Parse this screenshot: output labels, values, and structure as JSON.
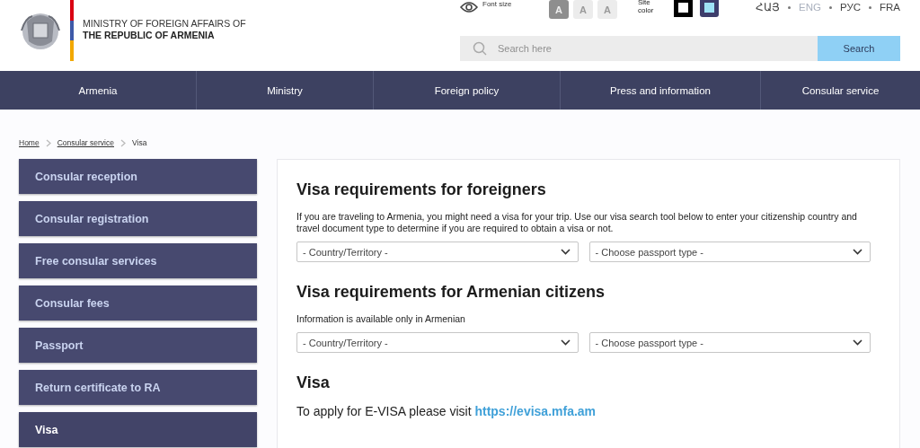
{
  "header": {
    "logo_line1": "MINISTRY OF FOREIGN AFFAIRS OF",
    "logo_line2": "THE REPUBLIC OF ARMENIA",
    "font_size_label": "Font size",
    "font_sizes": [
      {
        "label": "A",
        "selected": true
      },
      {
        "label": "A",
        "selected": false
      },
      {
        "label": "A",
        "selected": false
      }
    ],
    "site_color_label": "Site\ncolor",
    "site_colors": [
      {
        "color": "#000000",
        "selected": false
      },
      {
        "color": "#3d3d6b",
        "selected": true
      }
    ],
    "languages": [
      {
        "label": "ՀԱՅ",
        "selected": false
      },
      {
        "label": "ENG",
        "selected": true
      },
      {
        "label": "РУС",
        "selected": false
      },
      {
        "label": "FRA",
        "selected": false
      }
    ],
    "search": {
      "placeholder": "Search here",
      "button": "Search"
    }
  },
  "nav": [
    "Armenia",
    "Ministry",
    "Foreign policy",
    "Press and information",
    "Consular service"
  ],
  "breadcrumb": [
    {
      "label": "Home",
      "link": true
    },
    {
      "label": "Consular service",
      "link": true
    },
    {
      "label": "Visa",
      "link": false
    }
  ],
  "sidebar": [
    {
      "label": "Consular reception",
      "selected": false
    },
    {
      "label": "Consular registration",
      "selected": false
    },
    {
      "label": "Free consular services",
      "selected": false
    },
    {
      "label": "Consular fees",
      "selected": false
    },
    {
      "label": "Passport",
      "selected": false
    },
    {
      "label": "Return certificate to RA",
      "selected": false
    },
    {
      "label": "Visa",
      "selected": true
    }
  ],
  "content": [
    {
      "kind": "heading",
      "text": "Visa requirements for foreigners"
    },
    {
      "kind": "paragraph",
      "text": "If you are traveling to Armenia, you might need a visa for your trip. Use our visa search tool below to enter your citizenship country and travel document type to determine if you are required to obtain a visa or not."
    },
    {
      "kind": "selects",
      "items": [
        {
          "value": "- Country/Territory -"
        },
        {
          "value": "- Choose passport type -"
        }
      ]
    },
    {
      "kind": "heading",
      "text": "Visa requirements for Armenian citizens"
    },
    {
      "kind": "paragraph",
      "text": "Information is available only in Armenian"
    },
    {
      "kind": "selects",
      "items": [
        {
          "value": "- Country/Territory -"
        },
        {
          "value": "- Choose passport type -"
        }
      ]
    },
    {
      "kind": "heading",
      "text": "Visa"
    },
    {
      "kind": "link_line",
      "text": "To apply for E-VISA please visit",
      "link": "https://evisa.mfa.am"
    }
  ]
}
